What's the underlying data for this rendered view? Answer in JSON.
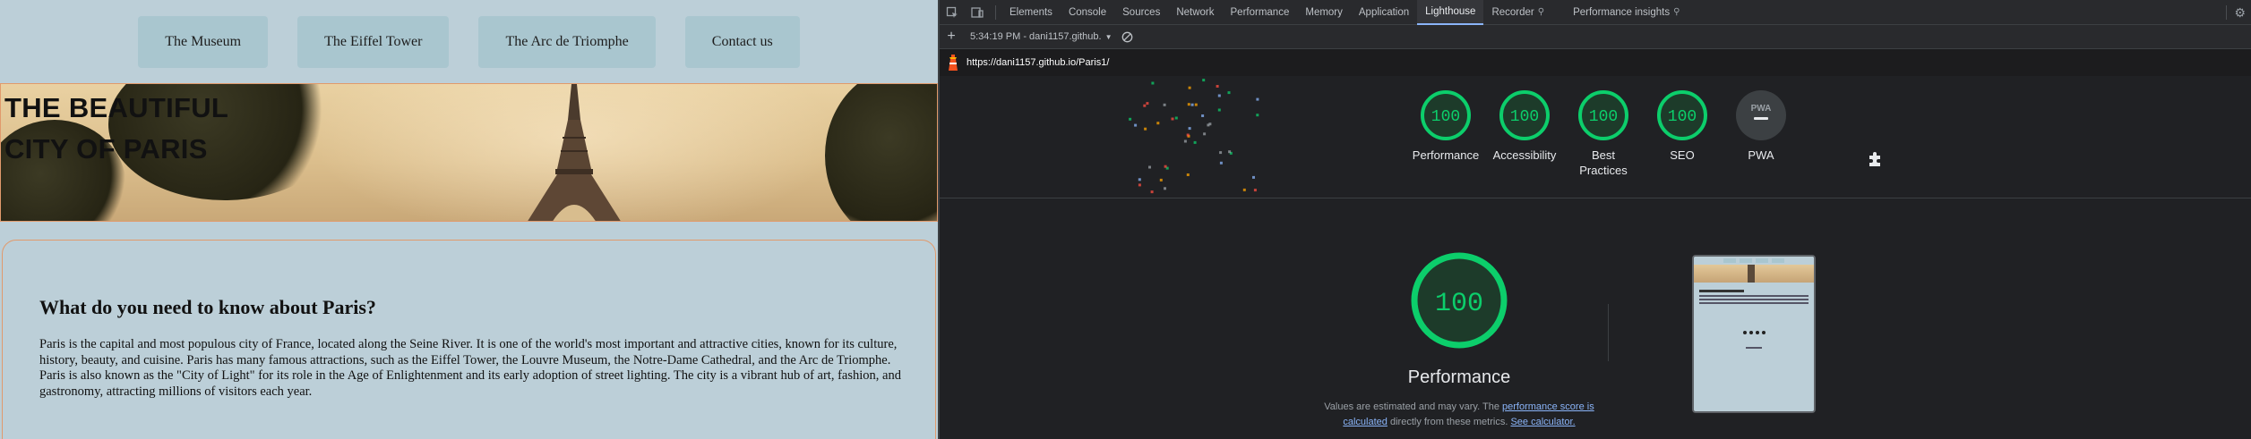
{
  "site": {
    "nav": [
      "The Museum",
      "The Eiffel Tower",
      "The Arc de Triomphe",
      "Contact us"
    ],
    "hero_title_line1": "THE BEAUTIFUL",
    "hero_title_line2": "CITY OF PARIS",
    "heading": "What do you need to know about Paris?",
    "paragraph": "Paris is the capital and most populous city of France, located along the Seine River. It is one of the world's most important and attractive cities, known for its culture, history, beauty, and cuisine. Paris has many famous attractions, such as the Eiffel Tower, the Louvre Museum, the Notre-Dame Cathedral, and the Arc de Triomphe. Paris is also known as the \"City of Light\" for its role in the Age of Enlightenment and its early adoption of street lighting. The city is a vibrant hub of art, fashion, and gastronomy, attracting millions of visitors each year."
  },
  "devtools": {
    "tabs": [
      "Elements",
      "Console",
      "Sources",
      "Network",
      "Performance",
      "Memory",
      "Application",
      "Lighthouse",
      "Recorder",
      "Performance insights"
    ],
    "active_tab": "Lighthouse",
    "report_select": "5:34:19 PM - dani1157.github.",
    "url": "https://dani1157.github.io/Paris1/",
    "categories": [
      {
        "label": "Performance",
        "score": "100"
      },
      {
        "label": "Accessibility",
        "score": "100"
      },
      {
        "label": "Best\nPractices",
        "score": "100"
      },
      {
        "label": "SEO",
        "score": "100"
      },
      {
        "label": "PWA",
        "score": "PWA"
      }
    ],
    "perf_score": "100",
    "perf_title": "Performance",
    "note_prefix": "Values are estimated and may vary. The ",
    "note_link1": "performance score is calculated",
    "note_mid": " directly from these metrics. ",
    "note_link2": "See calculator."
  },
  "colors": {
    "score_good": "#0cce6b",
    "score_bg": "#1d3b2a",
    "accent_link": "#8ab4f8",
    "hero_border": "#e19a6c"
  }
}
